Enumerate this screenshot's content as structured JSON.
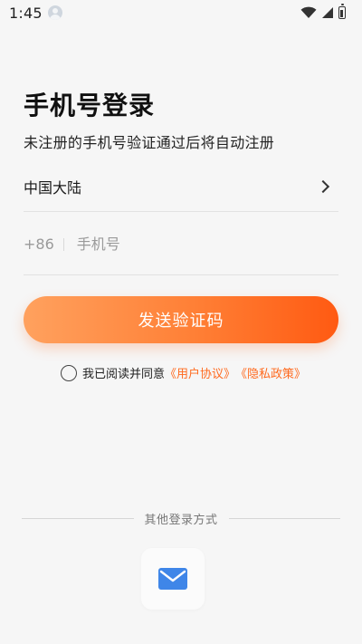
{
  "status_bar": {
    "time": "1:45",
    "icons": [
      "avatar-notification-icon",
      "wifi-icon",
      "signal-icon",
      "battery-icon"
    ]
  },
  "page": {
    "title": "手机号登录",
    "subtitle": "未注册的手机号验证通过后将自动注册"
  },
  "region": {
    "label": "中国大陆",
    "icon": "chevron-right-icon"
  },
  "phone": {
    "country_code": "+86",
    "placeholder": "手机号",
    "value": ""
  },
  "actions": {
    "send_code_label": "发送验证码"
  },
  "agreement": {
    "prefix": "我已阅读并同意",
    "user_agreement": "《用户协议》",
    "privacy_policy": "《隐私政策》"
  },
  "other_login": {
    "label": "其他登录方式",
    "options": [
      "email-icon"
    ]
  },
  "colors": {
    "accent": "#ff6a1f",
    "button_start": "#ffa15e",
    "button_end": "#ff5a12",
    "background": "#f6f6f6",
    "email_icon": "#3f86e8"
  }
}
